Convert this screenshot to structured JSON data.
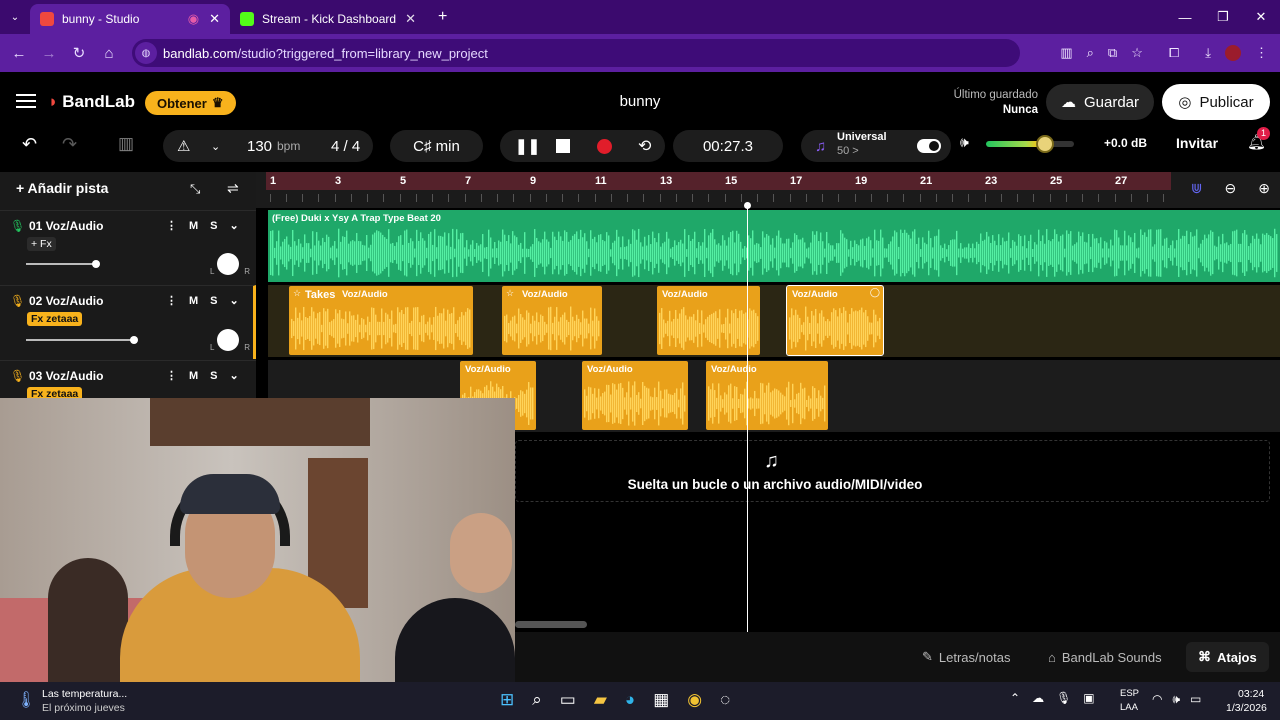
{
  "browser": {
    "tabs": [
      {
        "title": "bunny - Studio",
        "active": true
      },
      {
        "title": "Stream - Kick Dashboard",
        "active": false
      }
    ],
    "url_domain": "bandlab.com",
    "url_path": "/studio?triggered_from=library_new_project"
  },
  "header": {
    "logo": "BandLab",
    "obtener": "Obtener",
    "project_title": "bunny",
    "saved_label": "Último guardado",
    "saved_value": "Nunca",
    "guardar": "Guardar",
    "publicar": "Publicar"
  },
  "transport": {
    "tempo": "130",
    "tempo_unit": "bpm",
    "time_sig": "4 / 4",
    "key": "C♯ min",
    "time": "00:27.3",
    "instrument_name": "Universal",
    "instrument_sub": "50 >",
    "volume_db": "+0.0 dB",
    "invitar": "Invitar",
    "notif_count": "1"
  },
  "tracks_panel": {
    "add_track": "Añadir pista",
    "tracks": [
      {
        "name": "01  Voz/Audio",
        "fx": "+ Fx",
        "m": "M",
        "s": "S"
      },
      {
        "name": "02  Voz/Audio",
        "fx": "Fx zetaaa",
        "m": "M",
        "s": "S"
      },
      {
        "name": "03  Voz/Audio",
        "fx": "Fx zetaaa",
        "m": "M",
        "s": "S"
      }
    ]
  },
  "ruler": {
    "marks": [
      "1",
      "3",
      "5",
      "7",
      "9",
      "11",
      "13",
      "15",
      "17",
      "19",
      "21",
      "23",
      "25",
      "27"
    ]
  },
  "clips": {
    "lane1": "(Free) Duki  x Ysy A  Trap Type Beat  20",
    "lane2": [
      "Takes",
      "Voz/Audio",
      "Voz/Audio",
      "Voz/Audio",
      "Voz/Audio"
    ],
    "lane3": [
      "Voz/Audio",
      "Voz/Audio",
      "Voz/Audio"
    ]
  },
  "drop_text": "Suelta un bucle o un archivo audio/MIDI/video",
  "bottom": {
    "letras": "Letras/notas",
    "sounds": "BandLab Sounds",
    "atajos": "Atajos"
  },
  "taskbar": {
    "weather_title": "Las temperatura...",
    "weather_sub": "El próximo jueves",
    "lang1": "ESP",
    "lang2": "LAA",
    "time": "03:24",
    "date": "1/3/2026"
  },
  "colors": {
    "accent": "#f8b21c",
    "lane1": "#1fa869",
    "chrome": "#5c1fa0",
    "record": "#e11d2a"
  }
}
